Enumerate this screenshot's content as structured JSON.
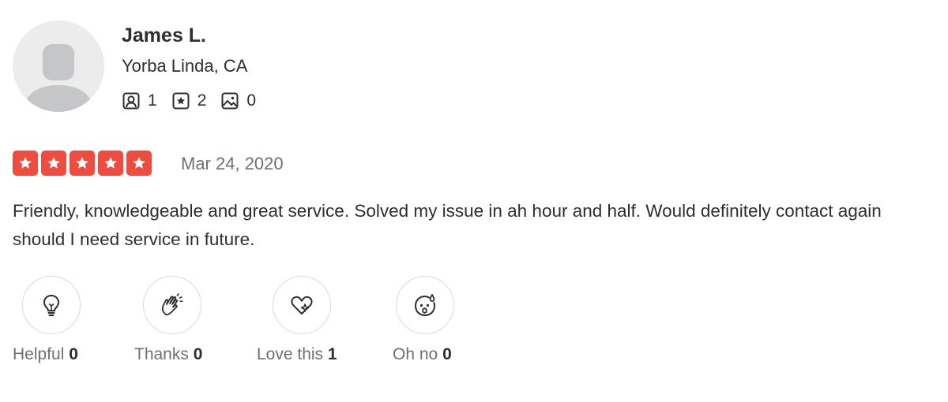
{
  "user": {
    "name": "James L.",
    "location": "Yorba Linda, CA",
    "stats": [
      {
        "icon": "friends-icon",
        "value": "1"
      },
      {
        "icon": "reviews-icon",
        "value": "2"
      },
      {
        "icon": "photos-icon",
        "value": "0"
      }
    ]
  },
  "review": {
    "rating": 5,
    "rating_max": 5,
    "star_color": "#ef4b3f",
    "date": "Mar 24, 2020",
    "text": "Friendly, knowledgeable and great service. Solved my issue in ah hour and half. Would definitely contact again should I need service in future."
  },
  "reactions": [
    {
      "icon": "lightbulb-icon",
      "label": "Helpful",
      "count": "0"
    },
    {
      "icon": "clapping-hands-icon",
      "label": "Thanks",
      "count": "0"
    },
    {
      "icon": "heart-sparkle-icon",
      "label": "Love this",
      "count": "1"
    },
    {
      "icon": "sweat-face-icon",
      "label": "Oh no",
      "count": "0"
    }
  ]
}
